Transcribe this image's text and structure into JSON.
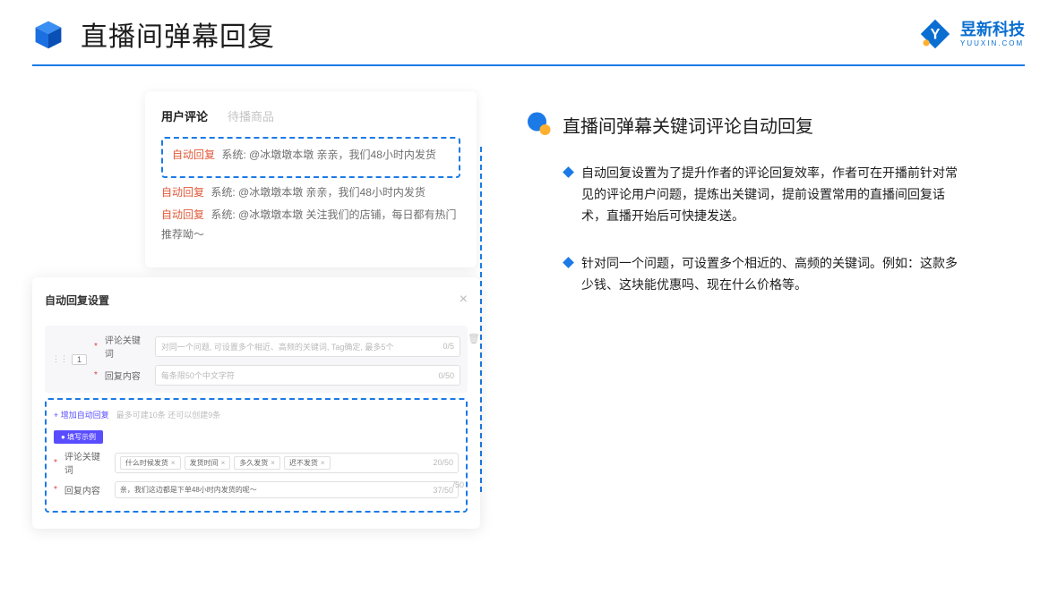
{
  "header": {
    "title": "直播间弹幕回复",
    "brand_name": "昱新科技",
    "brand_domain": "YUUXIN.COM"
  },
  "comment_card": {
    "tab_active": "用户评论",
    "tab_inactive": "待播商品",
    "highlight_prefix": "自动回复",
    "highlight_text": " 系统: @冰墩墩本墩 亲亲，我们48小时内发货",
    "item2_prefix": "自动回复",
    "item2_text": " 系统: @冰墩墩本墩 亲亲，我们48小时内发货",
    "item3_prefix": "自动回复",
    "item3_text": " 系统: @冰墩墩本墩 关注我们的店铺，每日都有热门推荐呦～"
  },
  "settings": {
    "title": "自动回复设置",
    "close": "×",
    "row_num": "1",
    "kw_label": "评论关键词",
    "kw_placeholder": "对同一个问题, 可设置多个相近、高频的关键词, Tag确定, 最多5个",
    "kw_count": "0/5",
    "reply_label": "回复内容",
    "reply_placeholder": "每条限50个中文字符",
    "reply_count": "0/50",
    "add_link": "+ 增加自动回复",
    "add_sub": "最多可建10条 还可以创建9条",
    "example_badge": "● 填写示例",
    "ex_kw_label": "评论关键词",
    "ex_tags": [
      "什么时候发货",
      "发货时间",
      "多久发货",
      "迟不发货"
    ],
    "ex_kw_count": "20/50",
    "ex_reply_label": "回复内容",
    "ex_reply_text": "亲，我们这边都是下单48小时内发货的呢～",
    "ex_reply_count": "37/50",
    "outside_count": "/50"
  },
  "right": {
    "section_title": "直播间弹幕关键词评论自动回复",
    "bullet1": "自动回复设置为了提升作者的评论回复效率，作者可在开播前针对常见的评论用户问题，提炼出关键词，提前设置常用的直播间回复话术，直播开始后可快捷发送。",
    "bullet2": "针对同一个问题，可设置多个相近的、高频的关键词。例如：这款多少钱、这块能优惠吗、现在什么价格等。"
  }
}
